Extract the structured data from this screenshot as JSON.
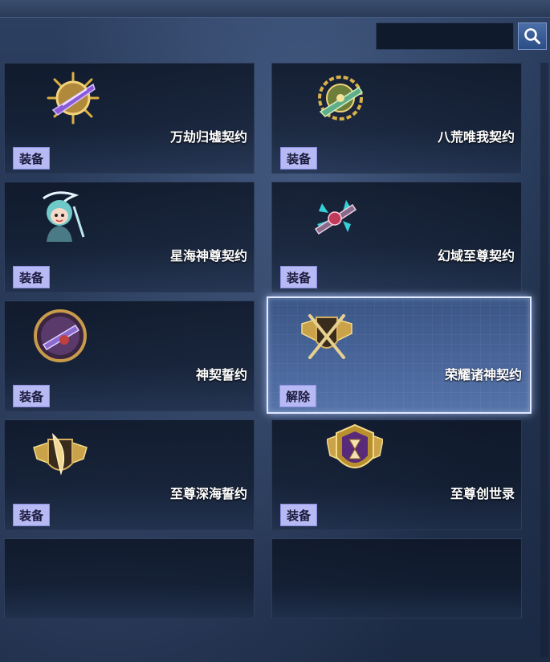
{
  "search": {
    "placeholder": "",
    "value": ""
  },
  "contracts": [
    {
      "name": "万劫归墟契约",
      "action": "装备",
      "icon": "purple-gold-weapon-icon"
    },
    {
      "name": "八荒唯我契约",
      "action": "装备",
      "icon": "green-gold-weapon-icon"
    },
    {
      "name": "星海神尊契约",
      "action": "装备",
      "icon": "chibi-character-icon"
    },
    {
      "name": "幻域至尊契约",
      "action": "装备",
      "icon": "cyan-crystal-weapon-icon"
    },
    {
      "name": "神契誓约",
      "action": "装备",
      "icon": "round-purple-emblem-icon"
    },
    {
      "name": "荣耀诸神契约",
      "action": "解除",
      "icon": "crossed-swords-shield-icon",
      "selected": true
    },
    {
      "name": "至尊深海誓约",
      "action": "装备",
      "icon": "gold-winged-shield-icon"
    },
    {
      "name": "至尊创世录",
      "action": "装备",
      "icon": "hourglass-badge-icon"
    }
  ],
  "colors": {
    "action_button": "#b7b9f5",
    "selected_card": "#4a679c",
    "search_button": "#3a5e98"
  }
}
